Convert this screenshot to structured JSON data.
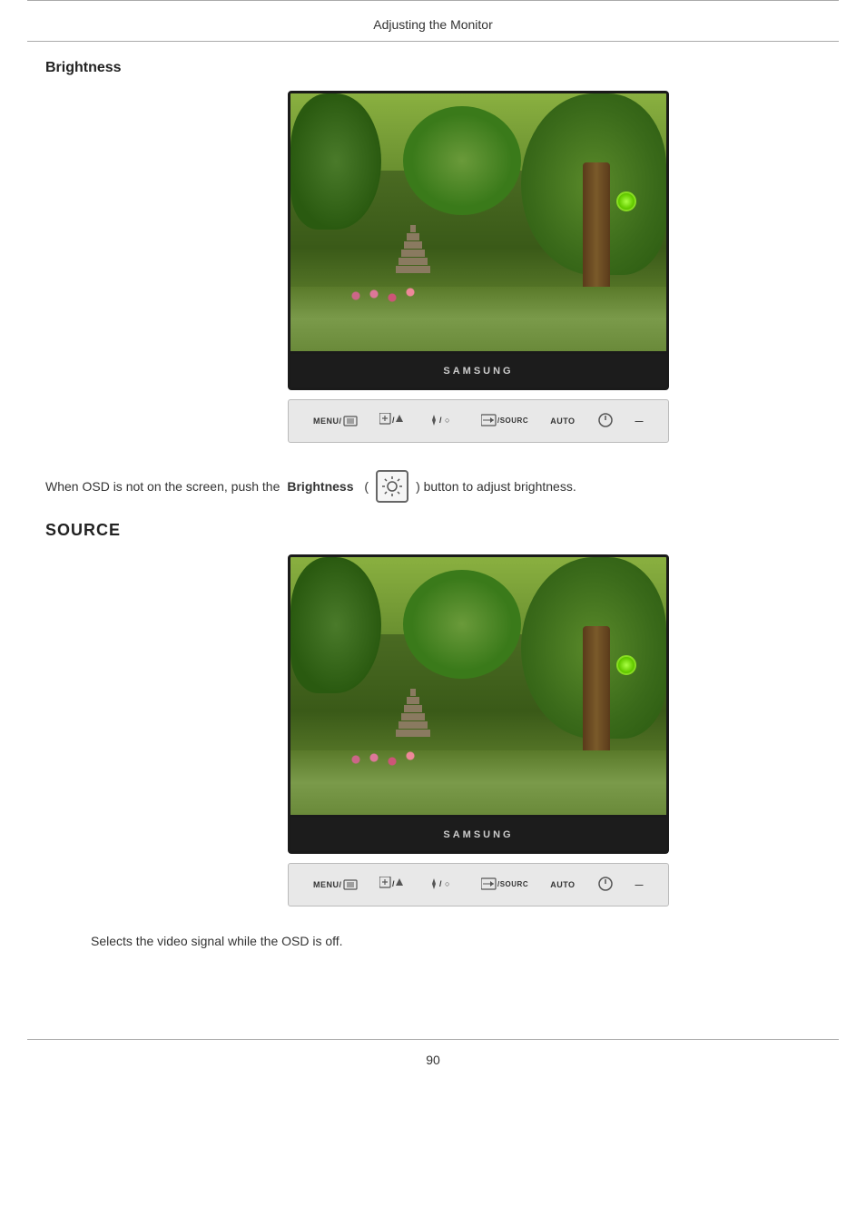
{
  "header": {
    "title": "Adjusting the Monitor"
  },
  "sections": {
    "brightness": {
      "title": "Brightness",
      "description_pre": "When OSD is not on the screen, push the ",
      "description_bold": "Brightness",
      "description_post": ") button to adjust brightness."
    },
    "source": {
      "title": "SOURCE",
      "description": "Selects the video signal while the OSD is off."
    }
  },
  "monitor_buttons": {
    "menu": "MENU/",
    "adjust": "▲/▼",
    "brightness_label": "▲ / ○",
    "source_label": "⇔/SOURCE",
    "auto": "AUTO",
    "power_label": "⏻",
    "dash": "—"
  },
  "footer": {
    "page_number": "90"
  }
}
